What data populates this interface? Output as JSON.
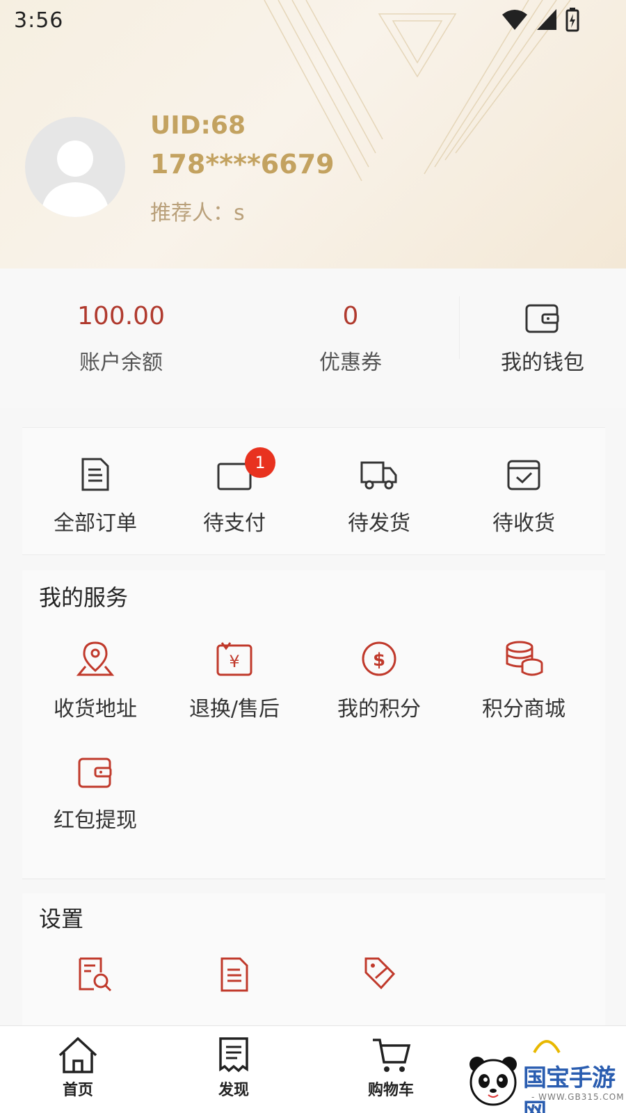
{
  "status_bar": {
    "time": "3:56"
  },
  "profile": {
    "uid": "UID:68",
    "phone": "178****6679",
    "referrer": "推荐人：s"
  },
  "balance": {
    "account_value": "100.00",
    "account_label": "账户余额",
    "coupon_value": "0",
    "coupon_label": "优惠券",
    "wallet_label": "我的钱包"
  },
  "orders": {
    "items": [
      {
        "label": "全部订单",
        "icon": "document-icon"
      },
      {
        "label": "待支付",
        "icon": "card-icon",
        "badge": "1"
      },
      {
        "label": "待发货",
        "icon": "truck-icon"
      },
      {
        "label": "待收货",
        "icon": "box-check-icon"
      }
    ]
  },
  "services": {
    "title": "我的服务",
    "items": [
      {
        "label": "收货地址",
        "icon": "location-icon"
      },
      {
        "label": "退换/售后",
        "icon": "refund-icon"
      },
      {
        "label": "我的积分",
        "icon": "points-icon"
      },
      {
        "label": "积分商城",
        "icon": "coins-icon"
      },
      {
        "label": "红包提现",
        "icon": "wallet-icon"
      }
    ]
  },
  "settings": {
    "title": "设置",
    "items": [
      {
        "icon": "doc-search-icon"
      },
      {
        "icon": "doc-list-icon"
      },
      {
        "icon": "tag-icon"
      }
    ]
  },
  "bottom_nav": {
    "items": [
      {
        "label": "首页",
        "icon": "home-icon"
      },
      {
        "label": "发现",
        "icon": "receipt-icon"
      },
      {
        "label": "购物车",
        "icon": "cart-icon"
      }
    ]
  },
  "watermark": {
    "title": "国宝手游网",
    "subtitle": "- WWW.GB315.COM -"
  },
  "colors": {
    "accent_red": "#b03a2e",
    "gold": "#c3a260",
    "badge_red": "#e8321f"
  }
}
